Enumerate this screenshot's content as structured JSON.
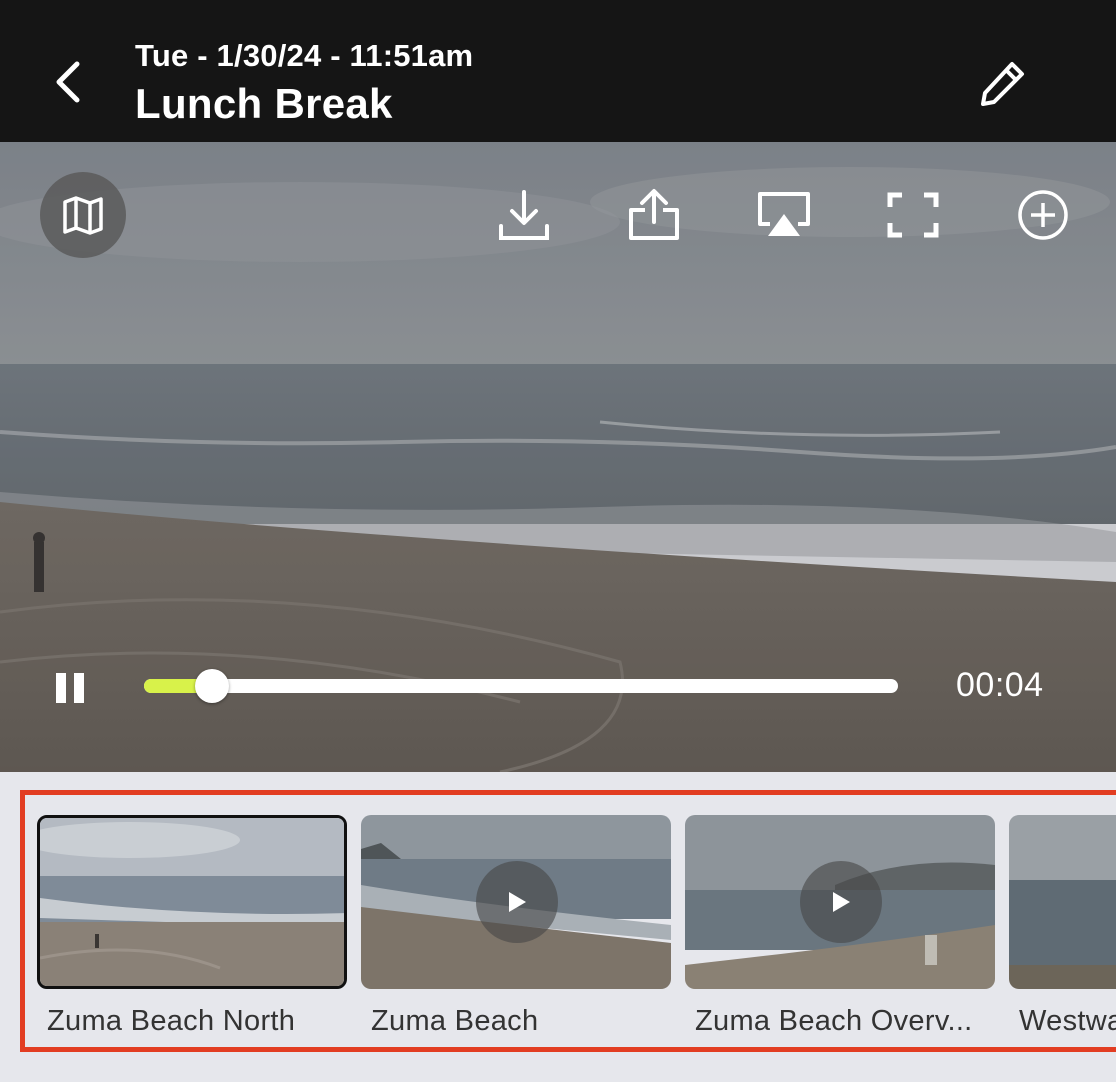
{
  "header": {
    "back_icon": "chevron-left-icon",
    "subtitle": "Tue - 1/30/24 - 11:51am",
    "title": "Lunch Break",
    "edit_icon": "pencil-icon"
  },
  "player": {
    "toolbar": [
      "map-icon",
      "download-icon",
      "share-icon",
      "airplay-icon",
      "fullscreen-icon",
      "add-circle-icon"
    ],
    "time": "00:04",
    "progress_fraction": 0.09,
    "accent_color": "#d8f24a",
    "state": "playing"
  },
  "cameras": {
    "highlight_color": "#e23d22",
    "items": [
      {
        "label": "Zuma Beach North",
        "active": true
      },
      {
        "label": "Zuma Beach",
        "active": false
      },
      {
        "label": "Zuma Beach Overv...",
        "active": false
      },
      {
        "label": "Westwa",
        "active": false
      }
    ]
  }
}
